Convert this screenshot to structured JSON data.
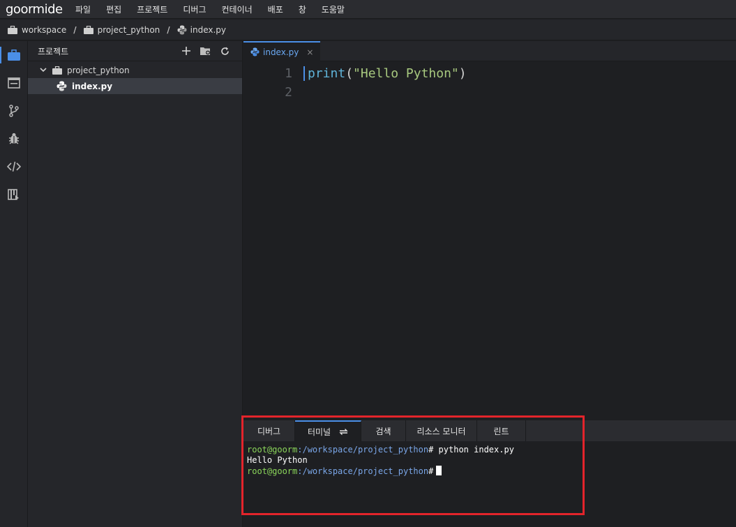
{
  "app": {
    "logo": "goormide"
  },
  "menu": [
    "파일",
    "편집",
    "프로젝트",
    "디버그",
    "컨테이너",
    "배포",
    "창",
    "도움말"
  ],
  "breadcrumb": {
    "workspace": "workspace",
    "project": "project_python",
    "file": "index.py",
    "separator": "/"
  },
  "activity": [
    "project-icon",
    "console-icon",
    "git-icon",
    "debug-icon",
    "code-icon",
    "bookmark-icon"
  ],
  "explorer": {
    "title": "프로젝트",
    "folder": "project_python",
    "file": "index.py"
  },
  "editor": {
    "tab": "index.py",
    "close": "×",
    "lines": [
      {
        "num": "1",
        "kw": "print",
        "open": "(",
        "str": "\"Hello Python\"",
        "close": ")"
      },
      {
        "num": "2"
      }
    ]
  },
  "panel": {
    "tabs": [
      "디버그",
      "터미널",
      "검색",
      "리소스 모니터",
      "린트"
    ],
    "terminal": {
      "user": "root@goorm",
      "path": ":/workspace/project_python",
      "prompt": "#",
      "command": " python index.py",
      "output": "Hello Python"
    }
  },
  "colors": {
    "accent": "#4b8fe7",
    "highlight": "#e3242b"
  }
}
